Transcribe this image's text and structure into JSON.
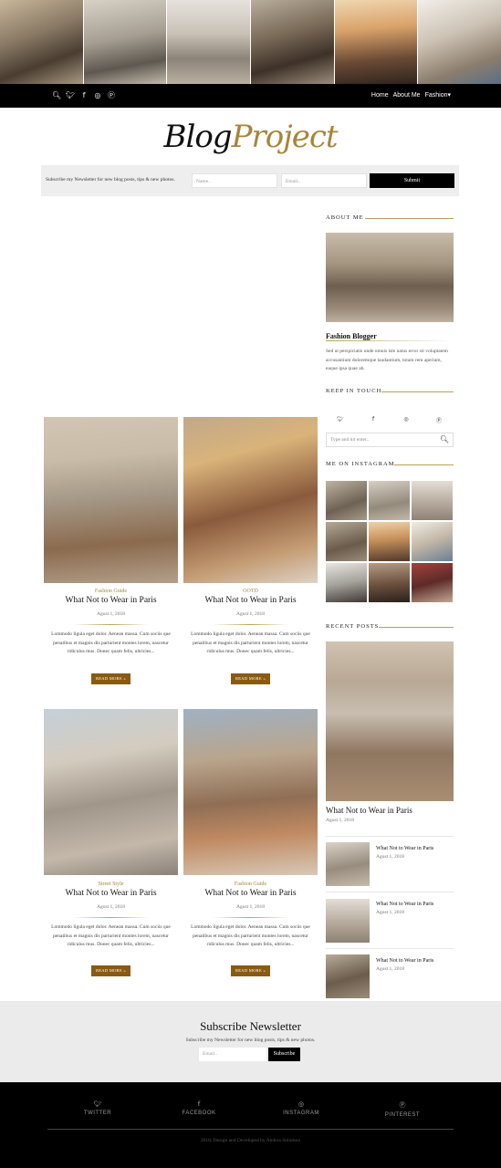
{
  "top_nav": {
    "social_icons": [
      "search-icon",
      "twitter-icon",
      "facebook-icon",
      "instagram-icon",
      "pinterest-icon"
    ],
    "menu": [
      "Home",
      "About Me",
      "Fashion"
    ]
  },
  "logo": {
    "part1": "Blog",
    "part2": "Project"
  },
  "newsletter_bar": {
    "text": "Subscribe my Newsletter for new blog posts, tips & new photos.",
    "name_placeholder": "Name..",
    "email_placeholder": "Email..",
    "submit_label": "Submit"
  },
  "posts": [
    {
      "category": "Fashion Guide",
      "title": "What Not to Wear in Paris",
      "date": "Agust 1, 2018",
      "excerpt": "Lommodo ligula eget dolor. Aenean massa. Cum sociis que penatibus et magnis dis parturient montes lorem, nascetur ridiculus mus. Donec quam felis, ultricies...",
      "read_more": "READ MORE"
    },
    {
      "category": "OOTD",
      "title": "What Not to Wear in Paris",
      "date": "Agust 1, 2018",
      "excerpt": "Lommodo ligula eget dolor. Aenean massa. Cum sociis que penatibus et magnis dis parturient montes lorem, nascetur ridiculus mus. Donec quam felis, ultricies...",
      "read_more": "READ MORE"
    },
    {
      "category": "Street Style",
      "title": "What Not to Wear in Paris",
      "date": "Agust 1, 2018",
      "excerpt": "Lommodo ligula eget dolor. Aenean massa. Cum sociis que penatibus et magnis dis parturient montes lorem, nascetur ridiculus mus. Donec quam felis, ultricies...",
      "read_more": "READ MORE"
    },
    {
      "category": "Fashion Guide",
      "title": "What Not to Wear in Paris",
      "date": "Agust 1, 2018",
      "excerpt": "Lommodo ligula eget dolor. Aenean massa. Cum sociis que penatibus et magnis dis parturient montes lorem, nascetur ridiculus mus. Donec quam felis, ultricies...",
      "read_more": "READ MORE"
    }
  ],
  "sidebar": {
    "about_heading": "ABOUT ME",
    "about_name": "Fashion Blogger",
    "about_text": "Sed ut perspiciatis unde omnis iste natus error sit voluptatem accusantium doloremque laudantium, totam rem aperiam, eaque ipsa quae ab.",
    "touch_heading": "KEEP IN TOUCH",
    "touch_icons": [
      "twitter-icon",
      "facebook-icon",
      "instagram-icon",
      "pinterest-icon"
    ],
    "search_placeholder": "Type and hit enter..",
    "instagram_heading": "ME ON INSTAGRAM",
    "recent_heading": "RECENT POSTS",
    "recent_big": {
      "title": "What Not to Wear in Paris",
      "date": "Agust 1, 2018"
    },
    "recent_list": [
      {
        "title": "What Not to Wear in Paris",
        "date": "Agust 1, 2018"
      },
      {
        "title": "What Not to Wear in Paris",
        "date": "Agust 1, 2018"
      },
      {
        "title": "What Not to Wear in Paris",
        "date": "Agust 1, 2018"
      }
    ]
  },
  "subscribe": {
    "heading": "Subscribe Newsletter",
    "sub": "Subscribe my Newsletter for new blog posts, tips & new photos.",
    "email_placeholder": "Email..",
    "button": "Subscribe"
  },
  "footer": {
    "social": [
      {
        "icon": "twitter-icon",
        "label": "TWITTER"
      },
      {
        "icon": "facebook-icon",
        "label": "FACEBOOK"
      },
      {
        "icon": "instagram-icon",
        "label": "INSTAGRAM"
      },
      {
        "icon": "pinterest-icon",
        "label": "PINTEREST"
      }
    ],
    "copyright": "2018, Design and Developed by Andrea Solomon"
  },
  "colors": {
    "accent": "#a8853a",
    "button": "#8a5a12",
    "dark": "#000000"
  }
}
